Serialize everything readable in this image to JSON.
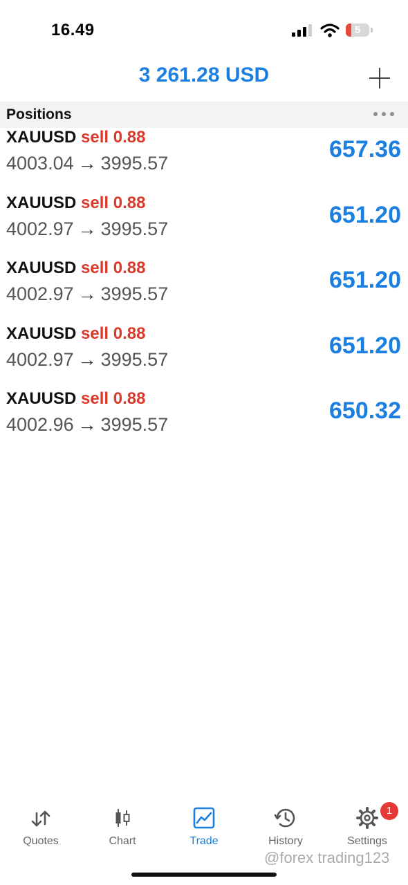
{
  "status_bar": {
    "time": "16.49",
    "battery": "5"
  },
  "header": {
    "balance": "3 261.28 USD"
  },
  "section": {
    "title": "Positions"
  },
  "positions": [
    {
      "symbol": "XAUUSD",
      "type": "sell",
      "volume": "0.88",
      "open_price": "4003.04",
      "arrow": "→",
      "current_price": "3995.57",
      "profit": "657.36"
    },
    {
      "symbol": "XAUUSD",
      "type": "sell",
      "volume": "0.88",
      "open_price": "4002.97",
      "arrow": "→",
      "current_price": "3995.57",
      "profit": "651.20"
    },
    {
      "symbol": "XAUUSD",
      "type": "sell",
      "volume": "0.88",
      "open_price": "4002.97",
      "arrow": "→",
      "current_price": "3995.57",
      "profit": "651.20"
    },
    {
      "symbol": "XAUUSD",
      "type": "sell",
      "volume": "0.88",
      "open_price": "4002.97",
      "arrow": "→",
      "current_price": "3995.57",
      "profit": "651.20"
    },
    {
      "symbol": "XAUUSD",
      "type": "sell",
      "volume": "0.88",
      "open_price": "4002.96",
      "arrow": "→",
      "current_price": "3995.57",
      "profit": "650.32"
    }
  ],
  "tabs": [
    {
      "label": "Quotes",
      "icon": "quotes-arrows-icon"
    },
    {
      "label": "Chart",
      "icon": "candlestick-icon"
    },
    {
      "label": "Trade",
      "icon": "trade-chart-icon",
      "active": true
    },
    {
      "label": "History",
      "icon": "history-clock-icon"
    },
    {
      "label": "Settings",
      "icon": "gear-icon",
      "badge": "1"
    }
  ],
  "watermark": "@forex trading123",
  "colors": {
    "accent": "#1a7fe0",
    "sell": "#d93a2b",
    "badge": "#e53935"
  }
}
